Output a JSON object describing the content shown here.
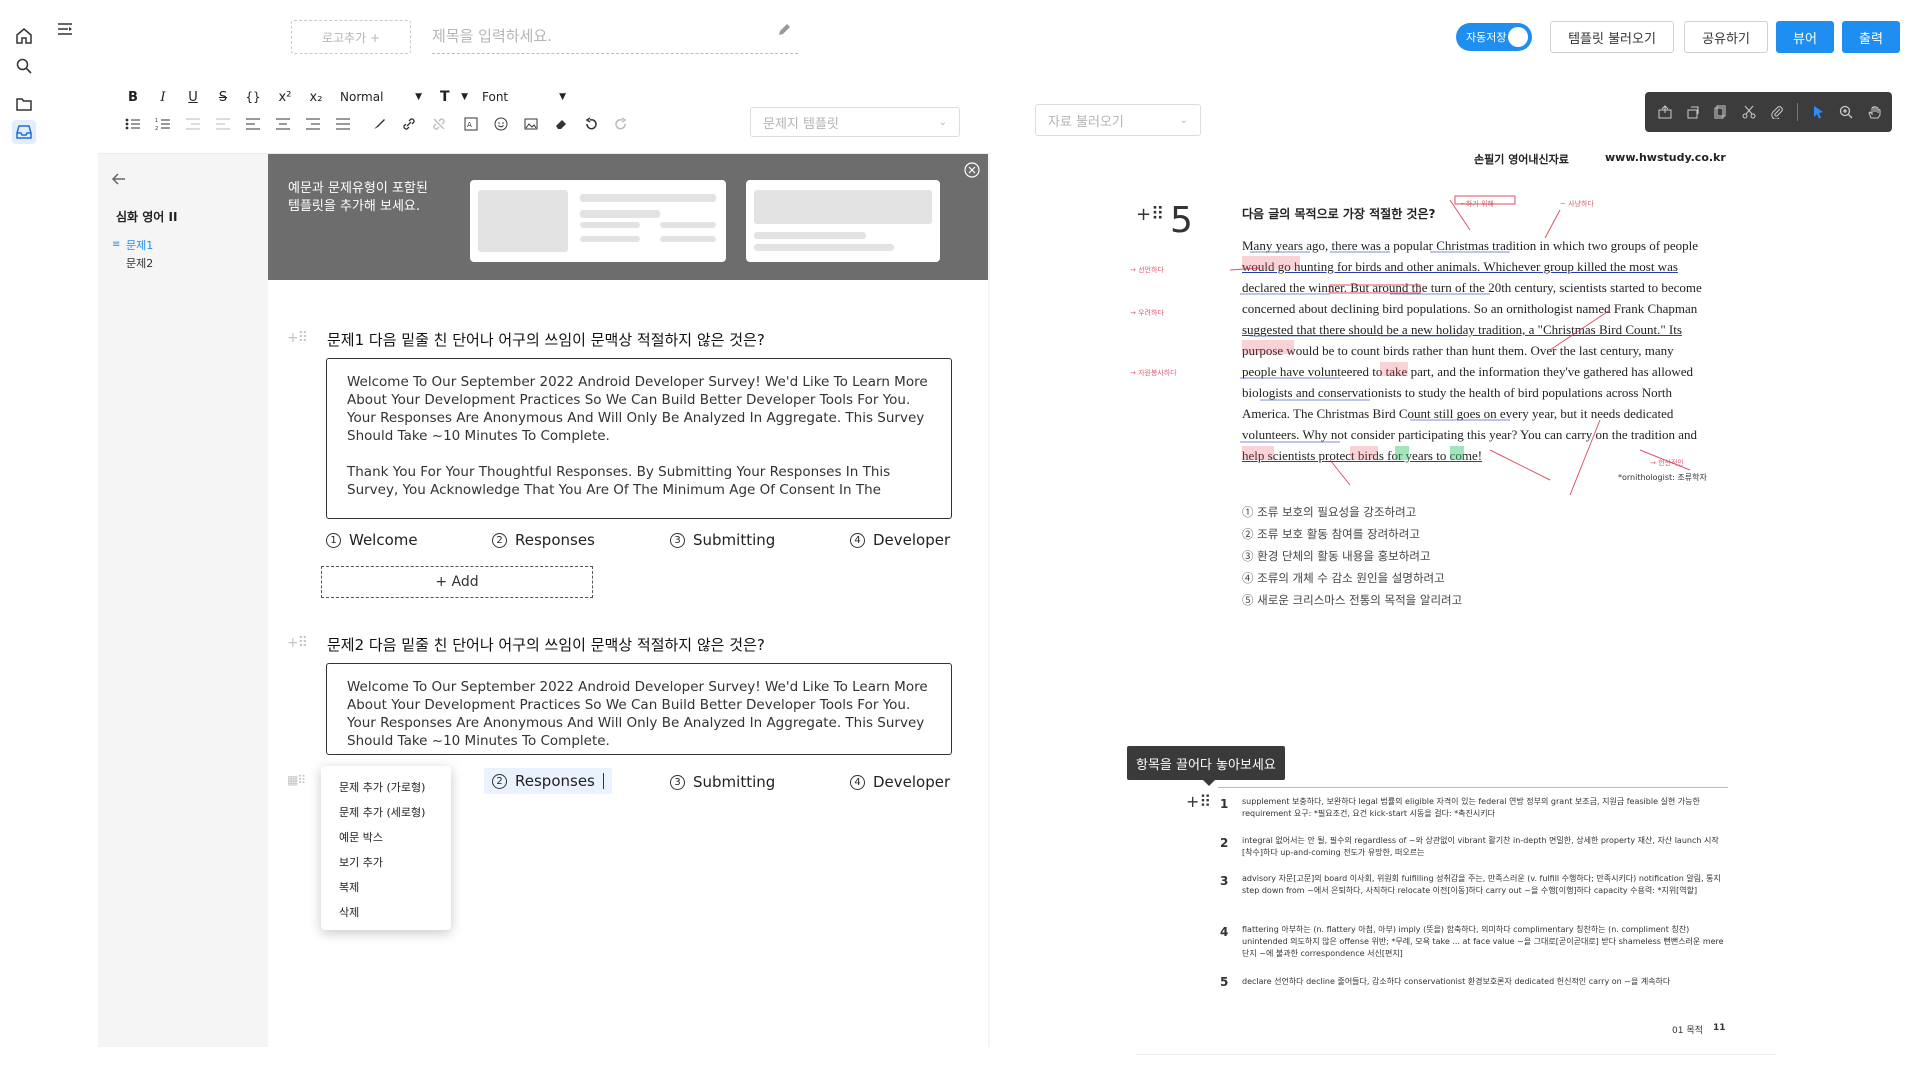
{
  "topbar": {
    "logo_placeholder": "로고추가 +",
    "title_placeholder": "제목을 입력하세요.",
    "autosave_label": "자동저장",
    "template_load": "템플릿 불러오기",
    "share": "공유하기",
    "viewer": "뷰어",
    "print": "출력"
  },
  "toolbar": {
    "bold": "B",
    "italic": "I",
    "underline": "U",
    "strike": "S",
    "code": "{}",
    "sup": "x²",
    "sub": "x₂",
    "heading_select": "Normal",
    "textsize": "T",
    "font_select": "Font",
    "template_select": "문제지 템플릿"
  },
  "sidebar": {
    "title": "심화 영어 II",
    "items": [
      {
        "label": "문제1",
        "active": true
      },
      {
        "label": "문제2",
        "active": false
      }
    ]
  },
  "banner": {
    "text": "예문과 문제유형이 포함된\n템플릿을 추가해 보세요."
  },
  "questions": [
    {
      "title": "문제1  다음 밑줄 친 단어나 어구의 쓰임이 문맥상 적절하지 않은 것은?",
      "passage_p1": "Welcome To Our September 2022 Android Developer Survey! We'd Like To Learn More About Your Development Practices So We Can Build Better Developer Tools For You. Your Responses Are Anonymous And Will Only Be Analyzed In Aggregate. This Survey Should Take ~10 Minutes To Complete.",
      "passage_p2": "Thank You For Your Thoughtful Responses. By Submitting Your Responses In This Survey, You Acknowledge That You Are Of The Minimum Age Of Consent In The",
      "choices": [
        {
          "num": "1",
          "label": "Welcome"
        },
        {
          "num": "2",
          "label": "Responses"
        },
        {
          "num": "3",
          "label": "Submitting"
        },
        {
          "num": "4",
          "label": "Developer"
        }
      ],
      "add_label": "+ Add"
    },
    {
      "title": "문제2  다음 밑줄 친 단어나 어구의 쓰임이 문맥상 적절하지 않은 것은?",
      "passage_p1": "Welcome To Our September 2022 Android Developer Survey! We'd Like To Learn More About Your Development Practices So We Can Build Better Developer Tools For You. Your Responses Are Anonymous And Will Only Be Analyzed In Aggregate. This Survey Should Take ~10 Minutes To Complete.",
      "choices": [
        {
          "num": "2",
          "label": "Responses"
        },
        {
          "num": "3",
          "label": "Submitting"
        },
        {
          "num": "4",
          "label": "Developer"
        }
      ]
    }
  ],
  "context_menu": [
    "문제 추가 (가로형)",
    "문제 추가 (세로형)",
    "예문 박스",
    "보기 추가",
    "복제",
    "삭제"
  ],
  "preview": {
    "load_select": "자료 불러오기",
    "header_left": "손필기  영어내신자료",
    "header_right": "www.hwstudy.co.kr",
    "q5_number": "5",
    "q5_title": "다음 글의 목적으로 가장 적절한 것은?",
    "english_lines": [
      "Many years ago, there was a popular Christmas tradition in which two groups of people",
      "would go hunting for birds and other animals. Whichever group killed the most was",
      "declared the winner. But around the turn of the 20th century, scientists started to become",
      "concerned about declining bird populations. So an ornithologist named Frank Chapman",
      "suggested that there should be a new holiday tradition, a \"Christmas Bird Count.\" Its",
      "purpose would be to count birds rather than hunt them. Over the last century, many",
      "people have volunteered to take part, and the information they've gathered has allowed",
      "biologists and conservationists to study the health of bird populations across North",
      "America. The Christmas Bird Count still goes on every year, but it needs dedicated",
      "volunteers. Why not consider participating this year? You can carry on the tradition and",
      "help scientists protect birds for years to come!"
    ],
    "footnote": "*ornithologist: 조류학자",
    "korean_choices": [
      "① 조류 보호의 필요성을 강조하려고",
      "② 조류 보호 활동 참여를 장려하려고",
      "③ 환경 단체의 활동 내용을 홍보하려고",
      "④ 조류의 개체 수 감소 원인을 설명하려고",
      "⑤ 새로운 크리스마스 전통의 목적을 알리려고"
    ],
    "tooltip": "항목을 끌어다 놓아보세요",
    "vocab": [
      {
        "num": "1",
        "text": "supplement 보충하다, 보완하다   legal 법률의   eligible 자격이 있는   federal 연방 정부의   grant 보조금, 지원금   feasible 실현 가능한   requirement 요구: *필요조건, 요건   kick-start 시동을 걸다: *촉진시키다"
      },
      {
        "num": "2",
        "text": "integral 없어서는 안 될, 필수의   regardless of ~와 상관없이   vibrant 활기찬   in-depth 면밀한, 상세한   property 재산, 자산   launch 시작[착수]하다   up-and-coming 전도가 유망한, 떠오르는"
      },
      {
        "num": "3",
        "text": "advisory 자문[고문]의   board 이사회, 위원회   fulfilling 성취감을 주는, 만족스러운 (v. fulfill 수행하다; 만족시키다)   notification 알림, 통지   step down from ~에서 은퇴하다, 사직하다   relocate 이전[이동]하다   carry out ~을 수행[이행]하다   capacity 수용력: *지위[역할]"
      },
      {
        "num": "4",
        "text": "flattering 아부하는 (n. flattery 아첨, 아부)   imply (뜻을) 함축하다, 의미하다   complimentary 칭찬하는 (n. compliment 칭찬)   unintended 의도하지 않은   offense 위반; *무례, 모욕   take ... at face value ~을 그대로[곧이곧대로] 받다   shameless 뻔뻔스러운   mere 단지 ~에 불과한   correspondence 서신[편지]"
      },
      {
        "num": "5",
        "text": "declare 선언하다   decline 줄어들다, 감소하다   conservationist 환경보호론자   dedicated 헌신적인   carry on ~을 계속하다"
      }
    ],
    "footer_label": "01 목적",
    "footer_page": "11"
  }
}
